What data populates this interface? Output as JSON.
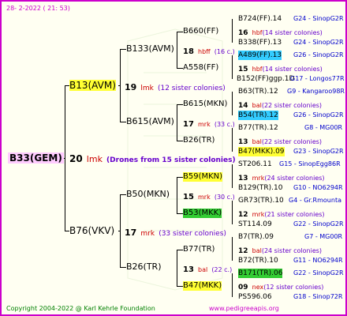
{
  "header": {
    "date": "28-  2-2022 ( 21: 53)"
  },
  "footer": {
    "copyright": "Copyright 2004-2022 @ Karl Kehrle Foundation",
    "site": "www.pedigreeapis.org"
  },
  "root": {
    "name": "B33(GEM)",
    "num": "20",
    "breeder": "lmk",
    "colonies": "(Drones from 15 sister colonies)"
  },
  "l1": [
    {
      "name": "B13(AVM)",
      "num": "19",
      "breeder": "lmk",
      "colonies": "(12 sister colonies)"
    },
    {
      "name": "B76(VKV)",
      "num": "17",
      "breeder": "mrk",
      "colonies": "(33 sister colonies)"
    }
  ],
  "l2": [
    {
      "name": "B133(AVM)",
      "num": "18",
      "breeder": "hbff",
      "colonies": "(16 c.)"
    },
    {
      "name": "B615(AVM)",
      "num": "17",
      "breeder": "mrk",
      "colonies": "(33 c.)"
    },
    {
      "name": "B50(MKN)",
      "num": "15",
      "breeder": "mrk",
      "colonies": "(30 c.)"
    },
    {
      "name": "B26(TR)",
      "num": "13",
      "breeder": "bal",
      "colonies": "(22 c.)"
    }
  ],
  "l3": [
    {
      "name": "B660(FF)"
    },
    {
      "name": "A558(FF)"
    },
    {
      "name": "B615(MKN)"
    },
    {
      "name": "B26(TR)"
    },
    {
      "name": "B59(MKN)"
    },
    {
      "name": "B53(MKK)"
    },
    {
      "name": "B77(TR)"
    },
    {
      "name": "B47(MKK)"
    }
  ],
  "l4": [
    {
      "name": "B724(FF).14",
      "src": "G24 - SinopG2R"
    },
    {
      "num": "16",
      "breeder": "hbf",
      "colonies": "(14 sister colonies)"
    },
    {
      "name": "B338(FF).13",
      "src": "G24 - SinopG2R"
    },
    {
      "name": "A489(FF).13",
      "src": "G26 - SinopG2R"
    },
    {
      "num": "15",
      "breeder": "hbf",
      "colonies": "(14 sister colonies)"
    },
    {
      "name": "B152(FF)ggp.1D",
      "src": "G17 - Longos77R"
    },
    {
      "name": "B63(TR).12",
      "src": "G9 - Kangaroo98R"
    },
    {
      "num": "14",
      "breeder": "bal",
      "colonies": "(22 sister colonies)"
    },
    {
      "name": "B54(TR).12",
      "src": "G26 - SinopG2R"
    },
    {
      "name": "B77(TR).12",
      "src": "G8 - MG00R"
    },
    {
      "num": "13",
      "breeder": "bal",
      "colonies": "(22 sister colonies)"
    },
    {
      "name": "B47(MKK).09",
      "src": "G23 - SinopG2R"
    },
    {
      "name": "ST206.11",
      "src": "G15 - SinopEgg86R"
    },
    {
      "num": "13",
      "breeder": "mrk",
      "colonies": "(24 sister colonies)"
    },
    {
      "name": "B129(TR).10",
      "src": "G10 - NO6294R"
    },
    {
      "name": "GR73(TR).10",
      "src": "G4 - Gr.Rmounta"
    },
    {
      "num": "12",
      "breeder": "mrk",
      "colonies": "(21 sister colonies)"
    },
    {
      "name": "ST114.09",
      "src": "G22 - SinopG2R"
    },
    {
      "name": "B7(TR).09",
      "src": "G7 - MG00R"
    },
    {
      "num": "12",
      "breeder": "bal",
      "colonies": "(24 sister colonies)"
    },
    {
      "name": "B72(TR).10",
      "src": "G11 - NO6294R"
    },
    {
      "name": "B171(TR).06",
      "src": "G22 - SinopG2R"
    },
    {
      "num": "09",
      "breeder": "nex",
      "colonies": "(12 sister colonies)"
    },
    {
      "name": "PS596.06",
      "src": "G18 - Sinop72R"
    }
  ],
  "colors": {
    "breeder": "#cc0000",
    "colonies": "#6600cc",
    "source": "#0000cc",
    "frame": "#cc00cc"
  }
}
